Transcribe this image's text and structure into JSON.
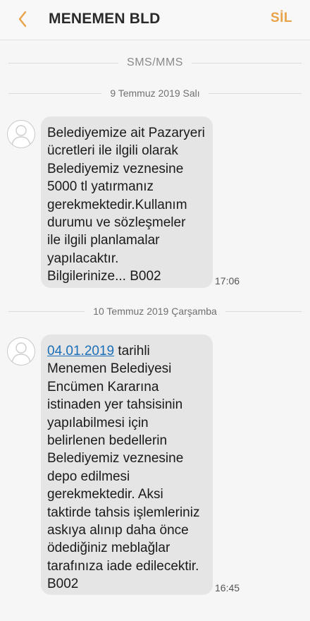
{
  "header": {
    "title": "MENEMEN BLD",
    "delete_label": "SİL"
  },
  "conversation": {
    "channel_label": "SMS/MMS",
    "messages": [
      {
        "date_separator": "9 Temmuz 2019 Salı",
        "lines": [
          "Belediyemize ait Pazaryeri",
          "ücretleri ile ilgili olarak",
          "Belediyemiz veznesine",
          "5000 tl yatırmanız",
          "gerekmektedir.Kullanım",
          "durumu ve sözleşmeler",
          "ile ilgili planlamalar",
          "yapılacaktır.",
          "Bilgilerinize... B002"
        ],
        "time": "17:06"
      },
      {
        "date_separator": "10 Temmuz 2019 Çarşamba",
        "link_text": "04.01.2019",
        "first_line_rest": " tarihli",
        "lines": [
          "Menemen Belediyesi",
          "Encümen Kararına",
          "istinaden yer tahsisinin",
          "yapılabilmesi için",
          "belirlenen bedellerin",
          "Belediyemiz veznesine",
          "depo edilmesi",
          "gerekmektedir. Aksi",
          "taktirde tahsis işlemleriniz",
          "askıya alınıp daha önce",
          "ödediğiniz meblağlar",
          "tarafınıza iade edilecektir.",
          "B002"
        ],
        "time": "16:45"
      }
    ]
  },
  "icons": {
    "back": "chevron-left-icon",
    "avatar": "person-silhouette-icon"
  },
  "colors": {
    "accent": "#e8a34a",
    "bubble": "#e5e5e5",
    "link": "#1a6fb8",
    "background": "#f6f6f6"
  }
}
